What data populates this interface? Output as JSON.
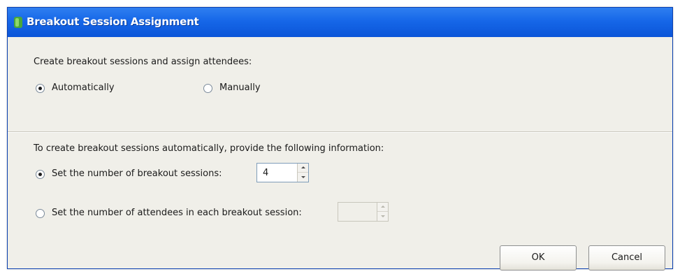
{
  "window": {
    "title": "Breakout Session Assignment",
    "title_color": "#1667e8",
    "icon": "app-logo-icon"
  },
  "assign_section": {
    "prompt": "Create breakout sessions and assign attendees:",
    "options": [
      {
        "label": "Automatically",
        "selected": true
      },
      {
        "label": "Manually",
        "selected": false
      }
    ]
  },
  "auto_section": {
    "prompt": "To create breakout sessions automatically, provide the following information:",
    "number_of_sessions": {
      "label": "Set the number of breakout sessions:",
      "selected": true,
      "value": "4"
    },
    "attendees_per_session": {
      "label": "Set the number of attendees in each breakout session:",
      "selected": false,
      "value": ""
    }
  },
  "buttons": {
    "ok": "OK",
    "cancel": "Cancel"
  }
}
